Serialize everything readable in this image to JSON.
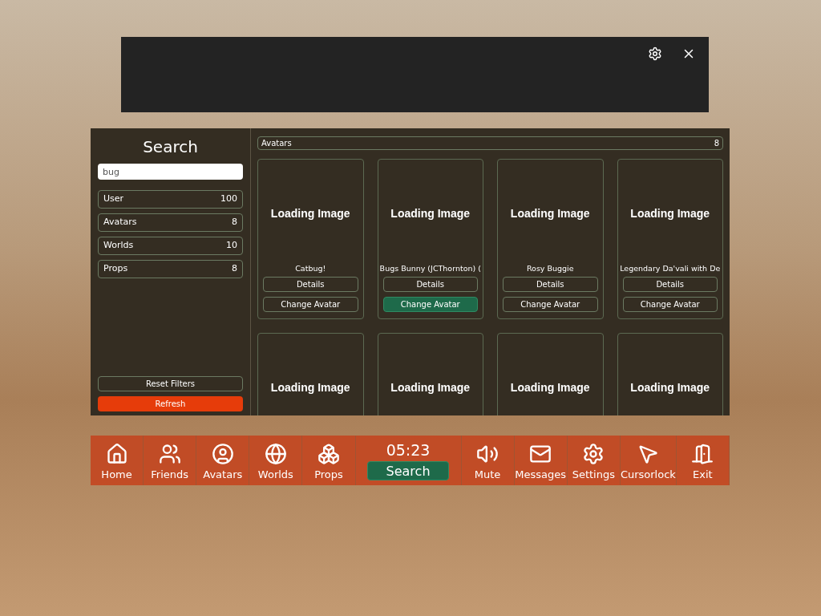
{
  "search_panel": {
    "title": "Search",
    "query": "bug",
    "categories": [
      {
        "label": "User",
        "count": "100"
      },
      {
        "label": "Avatars",
        "count": "8"
      },
      {
        "label": "Worlds",
        "count": "10"
      },
      {
        "label": "Props",
        "count": "8"
      }
    ],
    "reset_label": "Reset Filters",
    "refresh_label": "Refresh"
  },
  "results": {
    "header": "Avatars",
    "count": "8",
    "cards": [
      {
        "image_text": "Loading Image",
        "name": "Catbug!",
        "details": "Details",
        "change": "Change Avatar",
        "hovered": false
      },
      {
        "image_text": "Loading Image",
        "name": "Bugs Bunny (JCThornton) (",
        "details": "Details",
        "change": "Change Avatar",
        "hovered": true
      },
      {
        "image_text": "Loading Image",
        "name": "Rosy Buggie",
        "details": "Details",
        "change": "Change Avatar",
        "hovered": false
      },
      {
        "image_text": "Loading Image",
        "name": "Legendary Da'vali with De",
        "details": "Details",
        "change": "Change Avatar",
        "hovered": false
      },
      {
        "image_text": "Loading Image"
      },
      {
        "image_text": "Loading Image"
      },
      {
        "image_text": "Loading Image"
      },
      {
        "image_text": "Loading Image"
      }
    ]
  },
  "nav_bar": {
    "time": "05:23",
    "left": [
      {
        "kind": "home",
        "label": "Home"
      },
      {
        "kind": "friends",
        "label": "Friends"
      },
      {
        "kind": "avatars",
        "label": "Avatars"
      },
      {
        "kind": "worlds",
        "label": "Worlds"
      },
      {
        "kind": "props",
        "label": "Props"
      }
    ],
    "center": {
      "label": "Search",
      "selected": true
    },
    "right": [
      {
        "kind": "mute",
        "label": "Mute"
      },
      {
        "kind": "messages",
        "label": "Messages"
      },
      {
        "kind": "settings",
        "label": "Settings"
      },
      {
        "kind": "cursorlock",
        "label": "Cursorlock"
      },
      {
        "kind": "exit",
        "label": "Exit"
      }
    ]
  }
}
